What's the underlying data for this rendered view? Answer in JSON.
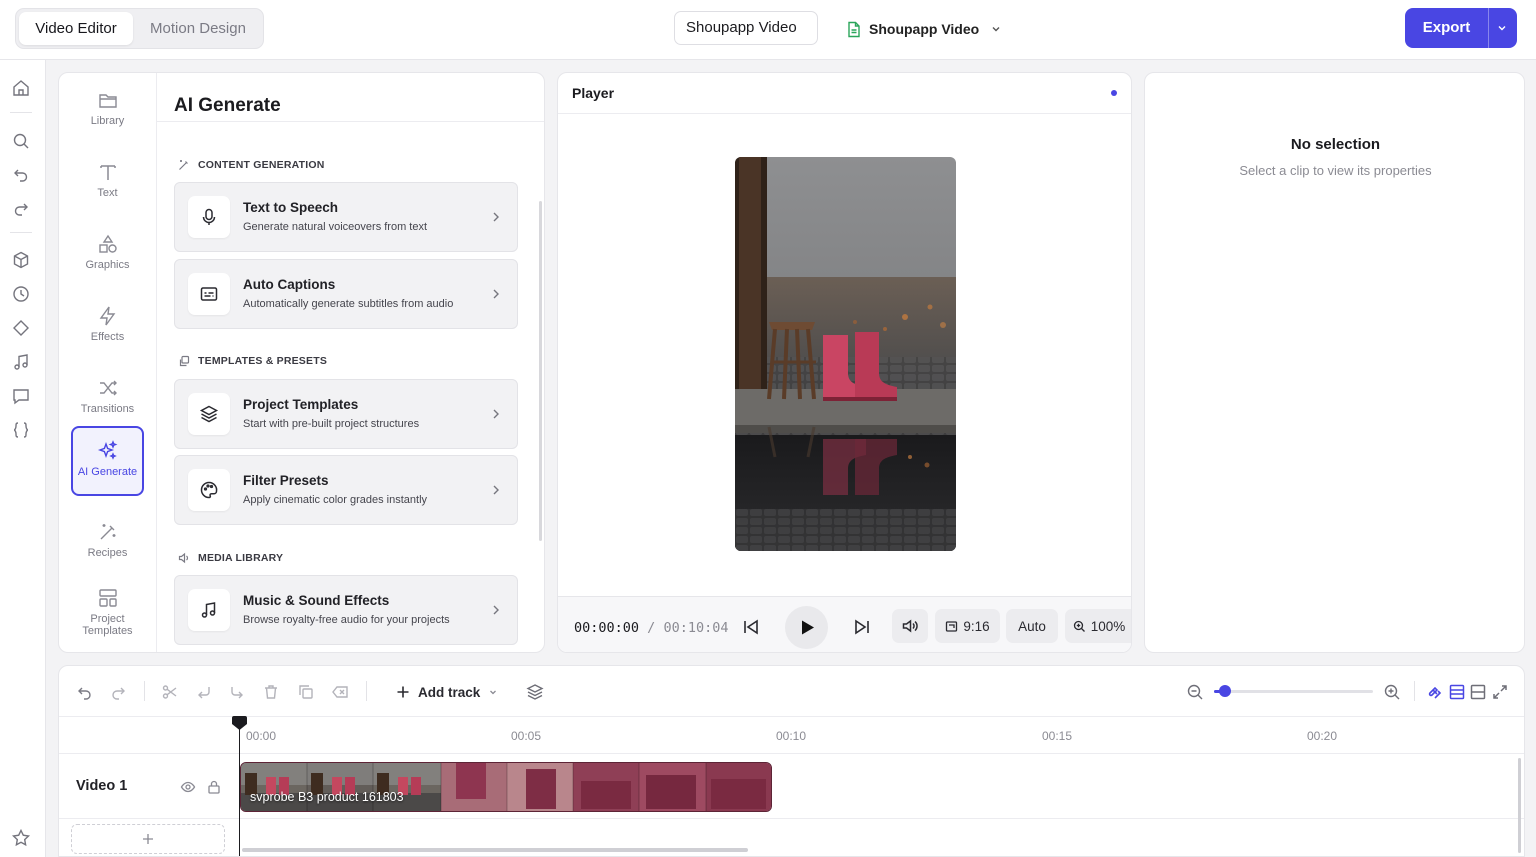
{
  "topbar": {
    "tabs": [
      {
        "label": "Video Editor",
        "active": true
      },
      {
        "label": "Motion Design",
        "active": false
      }
    ],
    "project_name": "Shoupapp Video",
    "project_selector": "Shoupapp Video",
    "export_label": "Export"
  },
  "rail": {
    "icons": [
      "home-icon",
      "search-icon",
      "undo-icon",
      "redo-icon",
      "cube-icon",
      "clock-icon",
      "diamond-icon",
      "music-icon",
      "comment-icon",
      "code-braces-icon",
      "star-icon"
    ]
  },
  "categories": [
    {
      "label": "Library",
      "icon": "folder-icon"
    },
    {
      "label": "Text",
      "icon": "text-icon"
    },
    {
      "label": "Graphics",
      "icon": "shapes-icon"
    },
    {
      "label": "Effects",
      "icon": "bolt-icon"
    },
    {
      "label": "Transitions",
      "icon": "shuffle-icon"
    },
    {
      "label": "AI Generate",
      "icon": "sparkles-icon",
      "active": true
    },
    {
      "label": "Recipes",
      "icon": "magic-wand-icon"
    },
    {
      "label": "Project Templates",
      "icon": "layout-icon"
    }
  ],
  "panel": {
    "title": "AI Generate",
    "sections": [
      {
        "label": "CONTENT GENERATION",
        "icon": "wand-icon"
      },
      {
        "label": "TEMPLATES & PRESETS",
        "icon": "copy-icon"
      },
      {
        "label": "MEDIA LIBRARY",
        "icon": "speaker-icon"
      }
    ],
    "cards": [
      {
        "title": "Text to Speech",
        "desc": "Generate natural voiceovers from text",
        "icon": "microphone-icon"
      },
      {
        "title": "Auto Captions",
        "desc": "Automatically generate subtitles from audio",
        "icon": "captions-icon"
      },
      {
        "title": "Project Templates",
        "desc": "Start with pre-built project structures",
        "icon": "layers-icon"
      },
      {
        "title": "Filter Presets",
        "desc": "Apply cinematic color grades instantly",
        "icon": "palette-icon"
      },
      {
        "title": "Music & Sound Effects",
        "desc": "Browse royalty-free audio for your projects",
        "icon": "music-note-icon"
      }
    ]
  },
  "player": {
    "title": "Player",
    "time_current": "00:00:00",
    "time_separator": "/",
    "time_total": "00:10:04",
    "aspect": "9:16",
    "quality": "Auto",
    "zoom": "100%"
  },
  "properties": {
    "title": "No selection",
    "subtitle": "Select a clip to view its properties"
  },
  "timeline": {
    "add_track_label": "Add track",
    "ticks": [
      "00:00",
      "00:05",
      "00:10",
      "00:15",
      "00:20"
    ],
    "zoom_level": 0.07,
    "tracks": [
      {
        "name": "Video 1",
        "clip_label": "svprobe B3 product 161803"
      }
    ]
  },
  "colors": {
    "accent": "#4946e3",
    "clip_color": "#8c3a52"
  }
}
